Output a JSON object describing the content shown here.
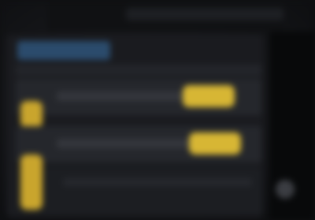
{
  "window": {
    "title": ""
  },
  "tabs": [
    {
      "label": ""
    }
  ],
  "rows": [
    {
      "label": "",
      "action": ""
    },
    {
      "label": "",
      "action": ""
    },
    {
      "label": ""
    }
  ],
  "colors": {
    "accent": "#d7b634",
    "tab_active": "#2b4b6c",
    "panel": "#1a1b1f",
    "background": "#0f1012"
  },
  "icons": [
    "app-icon",
    "action-button-icon"
  ]
}
